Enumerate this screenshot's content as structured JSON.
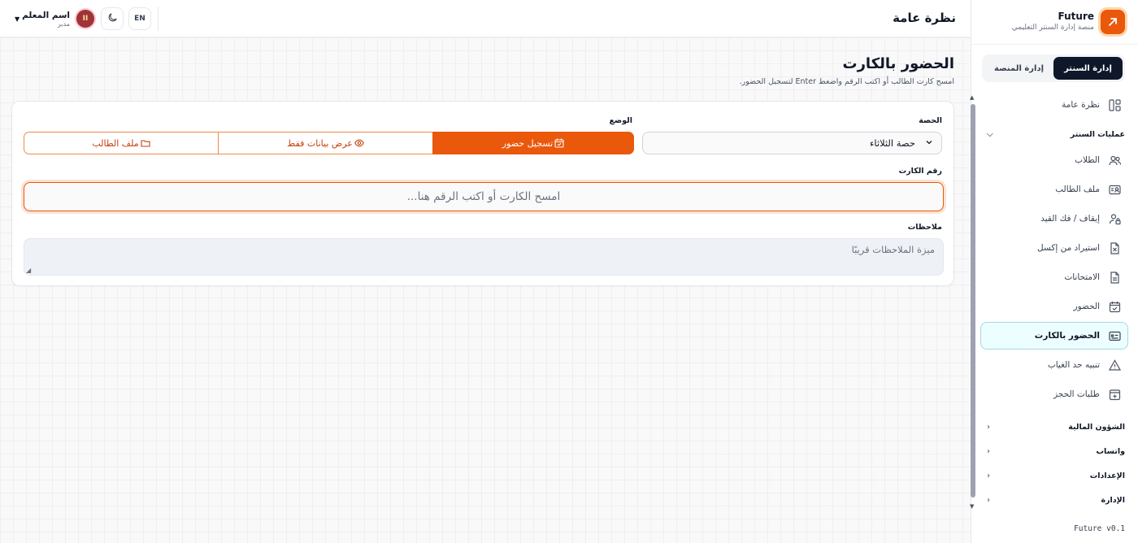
{
  "brand": {
    "name": "Future",
    "subtitle": "منصة إدارة السنتر التعليمي"
  },
  "switcher": {
    "platform": "إدارة المنصة",
    "center": "إدارة السنتر"
  },
  "sidebar": {
    "overview": "نظرة عامة",
    "group_ops": "عمليات السنتر",
    "items": [
      {
        "label": "الطلاب",
        "icon": "users-icon"
      },
      {
        "label": "ملف الطالب",
        "icon": "id-card-icon"
      },
      {
        "label": "إيقاف / فك القيد",
        "icon": "user-lock-icon"
      },
      {
        "label": "استيراد من إكسل",
        "icon": "excel-file-icon"
      },
      {
        "label": "الامتحانات",
        "icon": "document-icon"
      },
      {
        "label": "الحضور",
        "icon": "calendar-check-icon"
      },
      {
        "label": "الحضور بالكارت",
        "icon": "card-scan-icon"
      },
      {
        "label": "تنبيه حد الغياب",
        "icon": "warning-icon"
      },
      {
        "label": "طلبات الحجز",
        "icon": "calendar-plus-icon"
      }
    ],
    "groups": [
      "الشؤون المالية",
      "واتساب",
      "الإعدادات",
      "الإدارة"
    ],
    "footer": "Future v0.1"
  },
  "topbar": {
    "title": "نظرة عامة",
    "user_name": "اسم المعلم",
    "user_role": "مدير",
    "avatar_initial": "II",
    "lang": "EN"
  },
  "page": {
    "heading": "الحضور بالكارت",
    "subtitle": "امسح كارت الطالب أو اكتب الرقم واضغط Enter لتسجيل الحضور."
  },
  "form": {
    "session_label": "الحصة",
    "session_value": "حصة الثلاثاء",
    "mode_label": "الوضع",
    "modes": [
      "تسجيل حضور",
      "عرض بيانات فقط",
      "ملف الطالب"
    ],
    "card_label": "رقم الكارت",
    "card_placeholder": "امسح الكارت أو اكتب الرقم هنا...",
    "notes_label": "ملاحظات",
    "notes_placeholder": "ميزة الملاحظات قريبًا"
  },
  "colors": {
    "accent": "#ea580c",
    "dark": "#0f172a",
    "active_nav_bg": "#ecfeff"
  }
}
